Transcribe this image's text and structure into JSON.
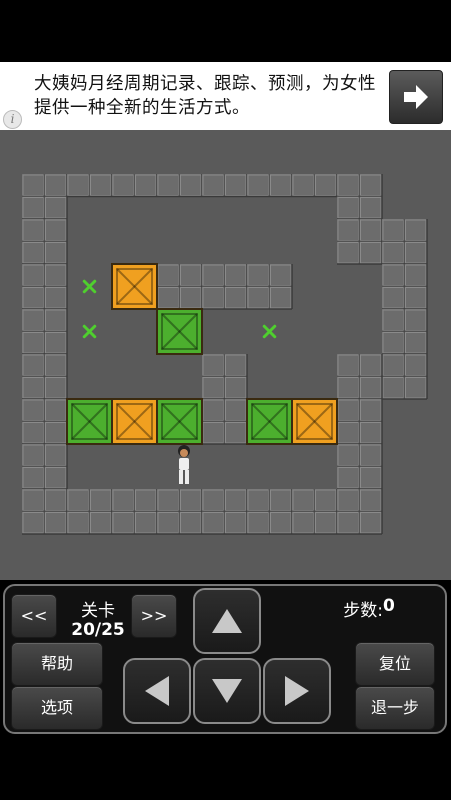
{
  "ad": {
    "text": "大姨妈月经周期记录、跟踪、预测，为女性提供一种全新的生活方式。"
  },
  "level": {
    "title": "关卡",
    "value": "20/25"
  },
  "steps": {
    "label": "步数:",
    "value": "0"
  },
  "buttons": {
    "prev": "<<",
    "next": ">>",
    "help": "帮助",
    "options": "选项",
    "reset": "复位",
    "undo": "退一步"
  },
  "icons": {
    "ad_arrow": "arrow-right-icon",
    "info": "info-icon",
    "up": "arrow-up-icon",
    "down": "arrow-down-icon",
    "left": "arrow-left-icon",
    "right": "arrow-right-icon"
  },
  "board": {
    "rows": [
      "##############...",
      "##############...",
      "##...........####",
      "##...........####",
      "##.xO#######..###",
      "##.x.........####",
      "##...G..#.x...###",
      "##......#....####",
      "##.ZZZ..ZZ##Z####",
      "##.GOG.##GO#.##..",
      "##.....PZ.....#..",
      "################."
    ],
    "legend": {
      "#": "wall",
      ".": "floor",
      "x": "target",
      "O": "crate",
      "G": "crate-on-target",
      "P": "player"
    }
  },
  "colors": {
    "background": "#5a5a5a",
    "wall": "#6c6c6c",
    "crate": "#f0a020",
    "crate_on_target": "#4caf2e",
    "target": "#4fcf2e"
  }
}
